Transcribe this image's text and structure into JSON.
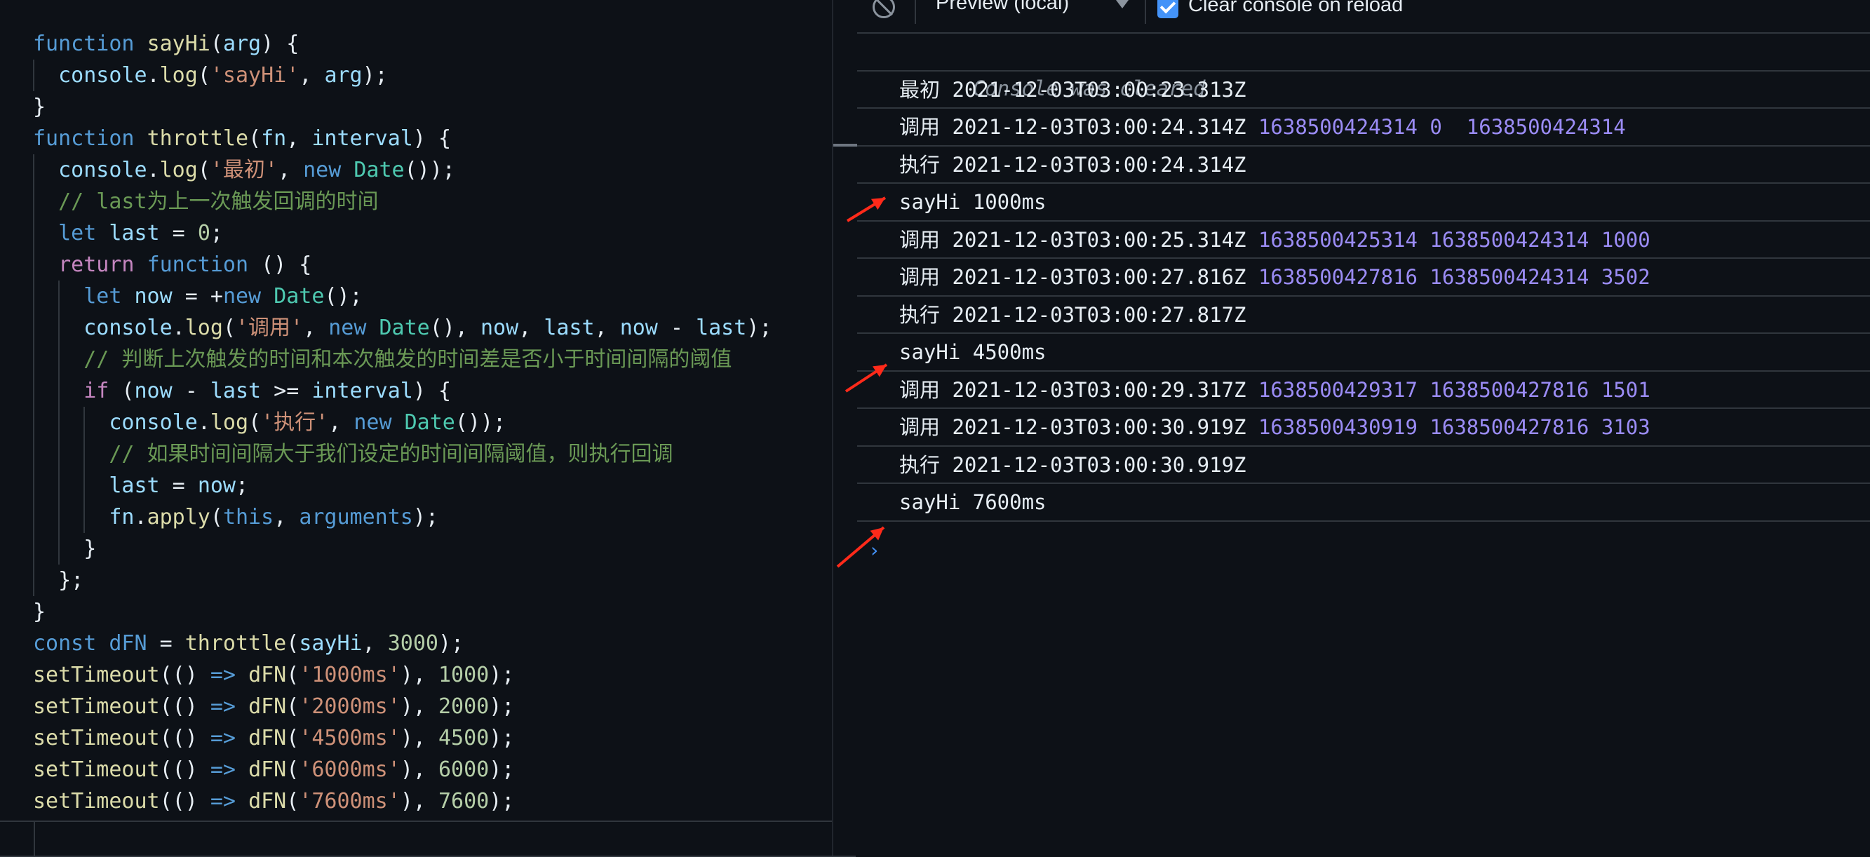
{
  "editor": {
    "lines": [
      [
        {
          "t": "function",
          "c": "kw"
        },
        {
          "t": " "
        },
        {
          "t": "sayHi",
          "c": "fn"
        },
        {
          "t": "("
        },
        {
          "t": "arg",
          "c": "var"
        },
        {
          "t": ") {"
        }
      ],
      [
        {
          "t": "  "
        },
        {
          "t": "console",
          "c": "var"
        },
        {
          "t": "."
        },
        {
          "t": "log",
          "c": "fn"
        },
        {
          "t": "("
        },
        {
          "t": "'sayHi'",
          "c": "str"
        },
        {
          "t": ", "
        },
        {
          "t": "arg",
          "c": "var"
        },
        {
          "t": ");"
        }
      ],
      [
        {
          "t": "}"
        }
      ],
      [
        {
          "t": "function",
          "c": "kw"
        },
        {
          "t": " "
        },
        {
          "t": "throttle",
          "c": "fn"
        },
        {
          "t": "("
        },
        {
          "t": "fn",
          "c": "var"
        },
        {
          "t": ", "
        },
        {
          "t": "interval",
          "c": "var"
        },
        {
          "t": ") {"
        }
      ],
      [
        {
          "t": "  "
        },
        {
          "t": "console",
          "c": "var"
        },
        {
          "t": "."
        },
        {
          "t": "log",
          "c": "fn"
        },
        {
          "t": "("
        },
        {
          "t": "'最初'",
          "c": "str"
        },
        {
          "t": ", "
        },
        {
          "t": "new",
          "c": "kw"
        },
        {
          "t": " "
        },
        {
          "t": "Date",
          "c": "cls"
        },
        {
          "t": "());"
        }
      ],
      [
        {
          "t": "  "
        },
        {
          "t": "// last为上一次触发回调的时间",
          "c": "cmt"
        }
      ],
      [
        {
          "t": "  "
        },
        {
          "t": "let",
          "c": "kw"
        },
        {
          "t": " "
        },
        {
          "t": "last",
          "c": "var"
        },
        {
          "t": " = "
        },
        {
          "t": "0",
          "c": "num"
        },
        {
          "t": ";"
        }
      ],
      [
        {
          "t": "  "
        },
        {
          "t": "return",
          "c": "ctl"
        },
        {
          "t": " "
        },
        {
          "t": "function",
          "c": "kw"
        },
        {
          "t": " () {"
        }
      ],
      [
        {
          "t": "    "
        },
        {
          "t": "let",
          "c": "kw"
        },
        {
          "t": " "
        },
        {
          "t": "now",
          "c": "var"
        },
        {
          "t": " = +"
        },
        {
          "t": "new",
          "c": "kw"
        },
        {
          "t": " "
        },
        {
          "t": "Date",
          "c": "cls"
        },
        {
          "t": "();"
        }
      ],
      [
        {
          "t": "    "
        },
        {
          "t": "console",
          "c": "var"
        },
        {
          "t": "."
        },
        {
          "t": "log",
          "c": "fn"
        },
        {
          "t": "("
        },
        {
          "t": "'调用'",
          "c": "str"
        },
        {
          "t": ", "
        },
        {
          "t": "new",
          "c": "kw"
        },
        {
          "t": " "
        },
        {
          "t": "Date",
          "c": "cls"
        },
        {
          "t": "(), "
        },
        {
          "t": "now",
          "c": "var"
        },
        {
          "t": ", "
        },
        {
          "t": "last",
          "c": "var"
        },
        {
          "t": ", "
        },
        {
          "t": "now",
          "c": "var"
        },
        {
          "t": " - "
        },
        {
          "t": "last",
          "c": "var"
        },
        {
          "t": ");"
        }
      ],
      [
        {
          "t": "    "
        },
        {
          "t": "// 判断上次触发的时间和本次触发的时间差是否小于时间间隔的阈值",
          "c": "cmt"
        }
      ],
      [
        {
          "t": "    "
        },
        {
          "t": "if",
          "c": "ctl"
        },
        {
          "t": " ("
        },
        {
          "t": "now",
          "c": "var"
        },
        {
          "t": " - "
        },
        {
          "t": "last",
          "c": "var"
        },
        {
          "t": " >= "
        },
        {
          "t": "interval",
          "c": "var"
        },
        {
          "t": ") {"
        }
      ],
      [
        {
          "t": "      "
        },
        {
          "t": "console",
          "c": "var"
        },
        {
          "t": "."
        },
        {
          "t": "log",
          "c": "fn"
        },
        {
          "t": "("
        },
        {
          "t": "'执行'",
          "c": "str"
        },
        {
          "t": ", "
        },
        {
          "t": "new",
          "c": "kw"
        },
        {
          "t": " "
        },
        {
          "t": "Date",
          "c": "cls"
        },
        {
          "t": "());"
        }
      ],
      [
        {
          "t": "      "
        },
        {
          "t": "// 如果时间间隔大于我们设定的时间间隔阈值，则执行回调",
          "c": "cmt"
        }
      ],
      [
        {
          "t": "      "
        },
        {
          "t": "last",
          "c": "var"
        },
        {
          "t": " = "
        },
        {
          "t": "now",
          "c": "var"
        },
        {
          "t": ";"
        }
      ],
      [
        {
          "t": "      "
        },
        {
          "t": "fn",
          "c": "var"
        },
        {
          "t": "."
        },
        {
          "t": "apply",
          "c": "fn"
        },
        {
          "t": "("
        },
        {
          "t": "this",
          "c": "kw"
        },
        {
          "t": ", "
        },
        {
          "t": "arguments",
          "c": "kw"
        },
        {
          "t": ");"
        }
      ],
      [
        {
          "t": "    }"
        }
      ],
      [
        {
          "t": "  };"
        }
      ],
      [
        {
          "t": "}"
        }
      ],
      [
        {
          "t": "const",
          "c": "kw"
        },
        {
          "t": " "
        },
        {
          "t": "dFN",
          "c": "kw"
        },
        {
          "t": " = "
        },
        {
          "t": "throttle",
          "c": "fn"
        },
        {
          "t": "("
        },
        {
          "t": "sayHi",
          "c": "var"
        },
        {
          "t": ", "
        },
        {
          "t": "3000",
          "c": "num"
        },
        {
          "t": ");"
        }
      ],
      [
        {
          "t": "setTimeout",
          "c": "fn"
        },
        {
          "t": "(() "
        },
        {
          "t": "=>",
          "c": "kw"
        },
        {
          "t": " "
        },
        {
          "t": "dFN",
          "c": "fn"
        },
        {
          "t": "("
        },
        {
          "t": "'1000ms'",
          "c": "str"
        },
        {
          "t": "), "
        },
        {
          "t": "1000",
          "c": "num"
        },
        {
          "t": ");"
        }
      ],
      [
        {
          "t": "setTimeout",
          "c": "fn"
        },
        {
          "t": "(() "
        },
        {
          "t": "=>",
          "c": "kw"
        },
        {
          "t": " "
        },
        {
          "t": "dFN",
          "c": "fn"
        },
        {
          "t": "("
        },
        {
          "t": "'2000ms'",
          "c": "str"
        },
        {
          "t": "), "
        },
        {
          "t": "2000",
          "c": "num"
        },
        {
          "t": ");"
        }
      ],
      [
        {
          "t": "setTimeout",
          "c": "fn"
        },
        {
          "t": "(() "
        },
        {
          "t": "=>",
          "c": "kw"
        },
        {
          "t": " "
        },
        {
          "t": "dFN",
          "c": "fn"
        },
        {
          "t": "("
        },
        {
          "t": "'4500ms'",
          "c": "str"
        },
        {
          "t": "), "
        },
        {
          "t": "4500",
          "c": "num"
        },
        {
          "t": ");"
        }
      ],
      [
        {
          "t": "setTimeout",
          "c": "fn"
        },
        {
          "t": "(() "
        },
        {
          "t": "=>",
          "c": "kw"
        },
        {
          "t": " "
        },
        {
          "t": "dFN",
          "c": "fn"
        },
        {
          "t": "("
        },
        {
          "t": "'6000ms'",
          "c": "str"
        },
        {
          "t": "), "
        },
        {
          "t": "6000",
          "c": "num"
        },
        {
          "t": ");"
        }
      ],
      [
        {
          "t": "setTimeout",
          "c": "fn"
        },
        {
          "t": "(() "
        },
        {
          "t": "=>",
          "c": "kw"
        },
        {
          "t": " "
        },
        {
          "t": "dFN",
          "c": "fn"
        },
        {
          "t": "("
        },
        {
          "t": "'7600ms'",
          "c": "str"
        },
        {
          "t": "), "
        },
        {
          "t": "7600",
          "c": "num"
        },
        {
          "t": ");"
        }
      ]
    ]
  },
  "console": {
    "toolbar": {
      "preview_label": "Preview (local)",
      "clear_on_reload_label": "Clear console on reload",
      "clear_on_reload_checked": true
    },
    "cleared_message": "Console was cleared",
    "rows": [
      {
        "text": "最初 2021-12-03T03:00:23.313Z",
        "nums": ""
      },
      {
        "text": "调用 2021-12-03T03:00:24.314Z",
        "nums": "1638500424314 0  1638500424314"
      },
      {
        "text": "执行 2021-12-03T03:00:24.314Z",
        "nums": ""
      },
      {
        "text": "sayHi 1000ms",
        "nums": ""
      },
      {
        "text": "调用 2021-12-03T03:00:25.314Z",
        "nums": "1638500425314 1638500424314 1000"
      },
      {
        "text": "调用 2021-12-03T03:00:27.816Z",
        "nums": "1638500427816 1638500424314 3502"
      },
      {
        "text": "执行 2021-12-03T03:00:27.817Z",
        "nums": ""
      },
      {
        "text": "sayHi 4500ms",
        "nums": ""
      },
      {
        "text": "调用 2021-12-03T03:00:29.317Z",
        "nums": "1638500429317 1638500427816 1501"
      },
      {
        "text": "调用 2021-12-03T03:00:30.919Z",
        "nums": "1638500430919 1638500427816 3103"
      },
      {
        "text": "执行 2021-12-03T03:00:30.919Z",
        "nums": ""
      },
      {
        "text": "sayHi 7600ms",
        "nums": ""
      }
    ],
    "prompt_symbol": "›",
    "annotation_color": "#ff2a1a"
  }
}
